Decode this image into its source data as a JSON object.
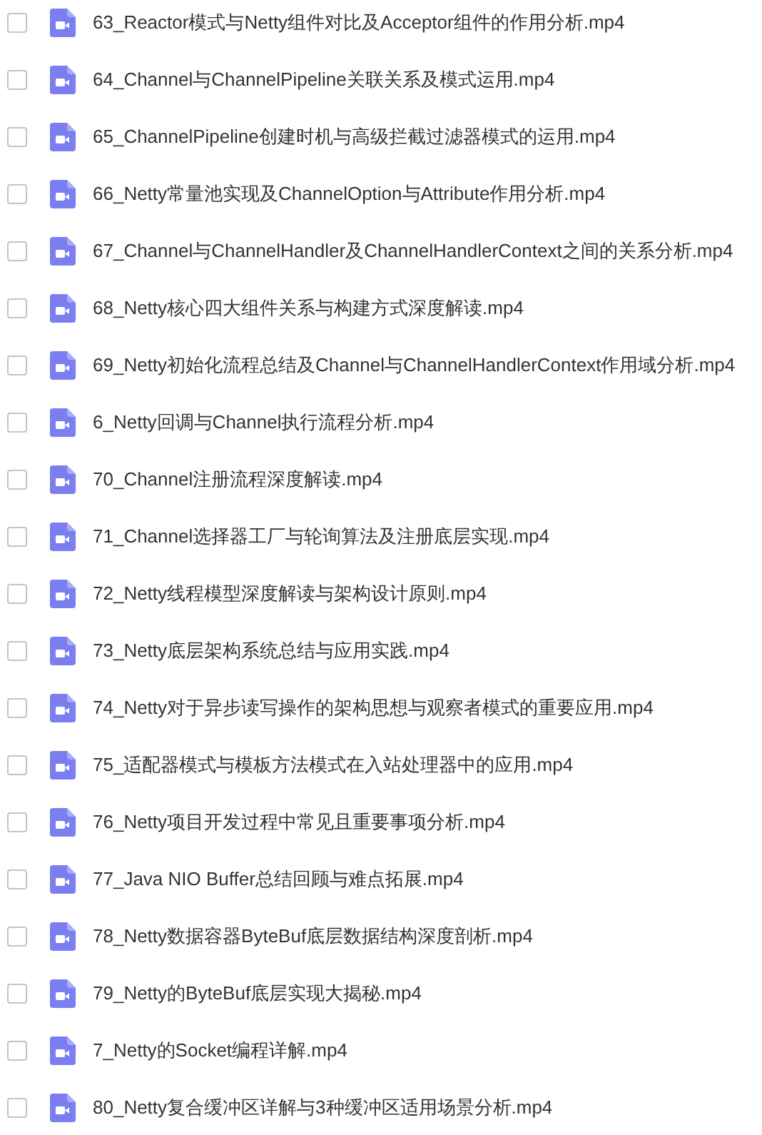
{
  "files": [
    {
      "name": "63_Reactor模式与Netty组件对比及Acceptor组件的作用分析.mp4",
      "checked": false
    },
    {
      "name": "64_Channel与ChannelPipeline关联关系及模式运用.mp4",
      "checked": false
    },
    {
      "name": "65_ChannelPipeline创建时机与高级拦截过滤器模式的运用.mp4",
      "checked": false
    },
    {
      "name": "66_Netty常量池实现及ChannelOption与Attribute作用分析.mp4",
      "checked": false
    },
    {
      "name": "67_Channel与ChannelHandler及ChannelHandlerContext之间的关系分析.mp4",
      "checked": false
    },
    {
      "name": "68_Netty核心四大组件关系与构建方式深度解读.mp4",
      "checked": false
    },
    {
      "name": "69_Netty初始化流程总结及Channel与ChannelHandlerContext作用域分析.mp4",
      "checked": false
    },
    {
      "name": "6_Netty回调与Channel执行流程分析.mp4",
      "checked": false
    },
    {
      "name": "70_Channel注册流程深度解读.mp4",
      "checked": false
    },
    {
      "name": "71_Channel选择器工厂与轮询算法及注册底层实现.mp4",
      "checked": false
    },
    {
      "name": "72_Netty线程模型深度解读与架构设计原则.mp4",
      "checked": false
    },
    {
      "name": "73_Netty底层架构系统总结与应用实践.mp4",
      "checked": false
    },
    {
      "name": "74_Netty对于异步读写操作的架构思想与观察者模式的重要应用.mp4",
      "checked": false
    },
    {
      "name": "75_适配器模式与模板方法模式在入站处理器中的应用.mp4",
      "checked": false
    },
    {
      "name": "76_Netty项目开发过程中常见且重要事项分析.mp4",
      "checked": false
    },
    {
      "name": "77_Java NIO Buffer总结回顾与难点拓展.mp4",
      "checked": false
    },
    {
      "name": "78_Netty数据容器ByteBuf底层数据结构深度剖析.mp4",
      "checked": false
    },
    {
      "name": "79_Netty的ByteBuf底层实现大揭秘.mp4",
      "checked": false
    },
    {
      "name": "7_Netty的Socket编程详解.mp4",
      "checked": false
    },
    {
      "name": "80_Netty复合缓冲区详解与3种缓冲区适用场景分析.mp4",
      "checked": false
    }
  ]
}
